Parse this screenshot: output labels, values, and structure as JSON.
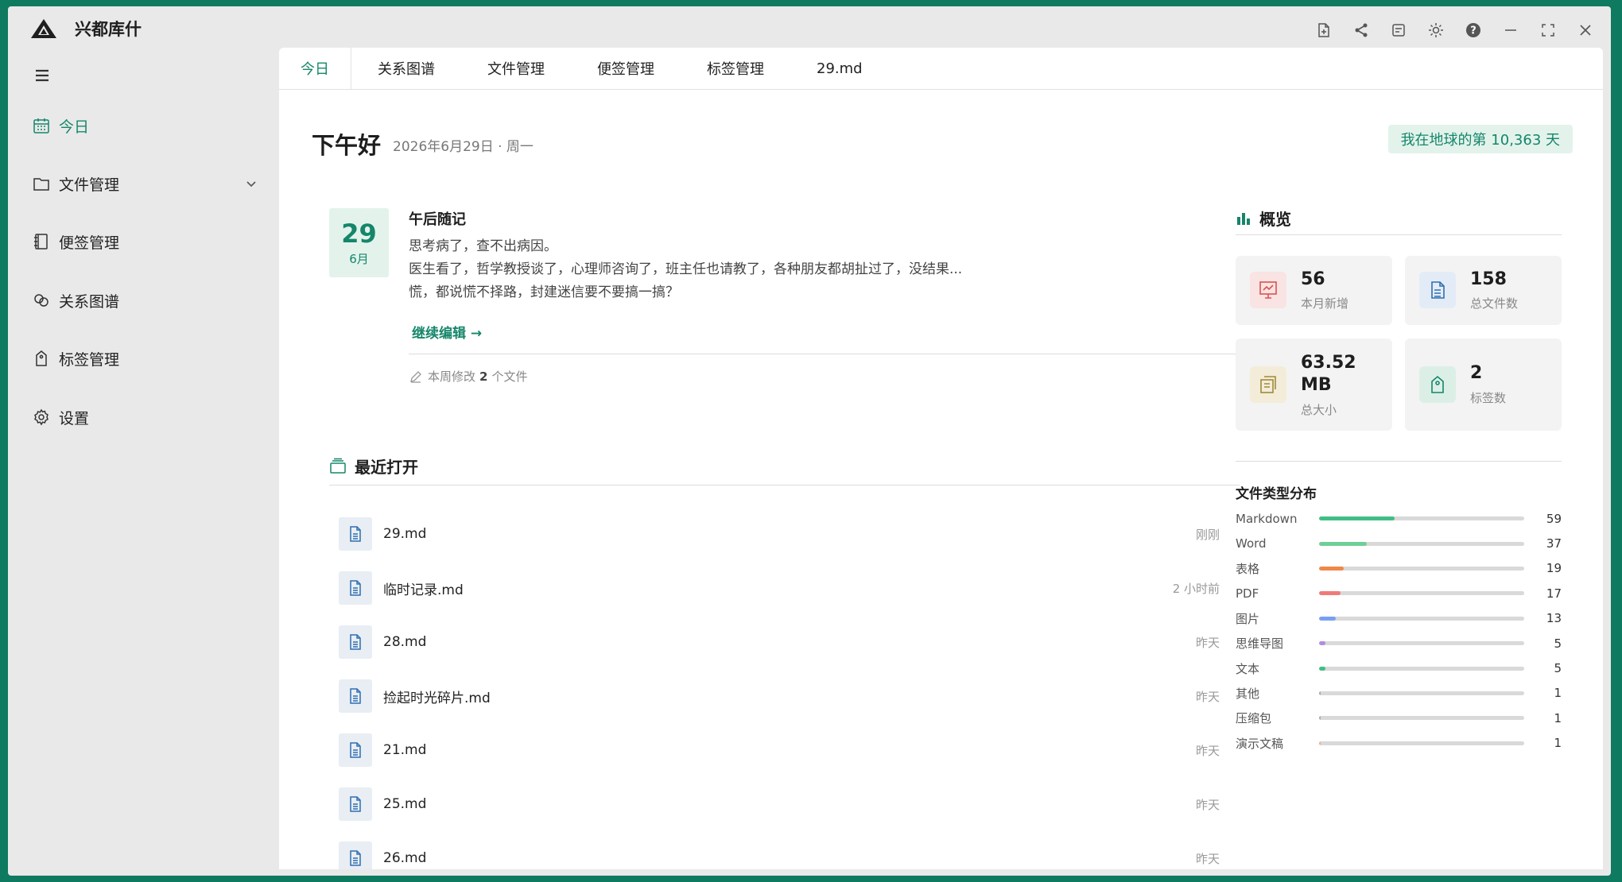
{
  "app": {
    "title": "兴都库什"
  },
  "titlebar": {
    "icons": [
      "new-file-icon",
      "share-icon",
      "export-icon",
      "theme-sun-icon",
      "help-icon",
      "minimize-icon",
      "maximize-icon",
      "close-icon"
    ]
  },
  "sidebar": {
    "items": [
      {
        "label": "今日",
        "icon": "calendar-icon",
        "active": true
      },
      {
        "label": "文件管理",
        "icon": "folder-icon",
        "expandable": true
      },
      {
        "label": "便签管理",
        "icon": "notebook-icon"
      },
      {
        "label": "关系图谱",
        "icon": "graph-icon"
      },
      {
        "label": "标签管理",
        "icon": "tag-icon"
      },
      {
        "label": "设置",
        "icon": "gear-icon"
      }
    ]
  },
  "tabs": [
    "今日",
    "关系图谱",
    "文件管理",
    "便签管理",
    "标签管理",
    "29.md"
  ],
  "header": {
    "greeting": "下午好",
    "date": "2026年6月29日 · 周一",
    "earth_days": "我在地球的第 10,363 天"
  },
  "note": {
    "day": "29",
    "month": "6月",
    "title": "午后随记",
    "lines": [
      "思考病了，查不出病因。",
      "医生看了，哲学教授谈了，心理师咨询了，班主任也请教了，各种朋友都胡扯过了，没结果...",
      "慌，都说慌不择路，封建迷信要不要搞一搞？"
    ],
    "continue": "继续编辑 →",
    "week_prefix": "本周修改",
    "week_count": "2",
    "week_suffix": "个文件"
  },
  "recent": {
    "title": "最近打开",
    "items": [
      {
        "name": "29.md",
        "time": "刚刚"
      },
      {
        "name": "临时记录.md",
        "time": "2 小时前"
      },
      {
        "name": "28.md",
        "time": "昨天"
      },
      {
        "name": "捡起时光碎片.md",
        "time": "昨天"
      },
      {
        "name": "21.md",
        "time": "昨天"
      },
      {
        "name": "25.md",
        "time": "昨天"
      },
      {
        "name": "26.md",
        "time": "昨天"
      }
    ]
  },
  "overview": {
    "title": "概览",
    "stats": [
      {
        "value": "56",
        "label": "本月新增",
        "icon": "chart-board-icon",
        "color": "#d9534f"
      },
      {
        "value": "158",
        "label": "总文件数",
        "icon": "document-icon",
        "color": "#2f6fb0"
      },
      {
        "value": "63.52 MB",
        "label": "总大小",
        "icon": "stack-icon",
        "color": "#a08a3a"
      },
      {
        "value": "2",
        "label": "标签数",
        "icon": "tag-icon",
        "color": "#15866a"
      }
    ]
  },
  "file_types": {
    "title": "文件类型分布",
    "items": [
      {
        "label": "Markdown",
        "count": 59,
        "ratio": 0.369,
        "color": "#3fbf84"
      },
      {
        "label": "Word",
        "count": 37,
        "ratio": 0.231,
        "color": "#6fcf97"
      },
      {
        "label": "表格",
        "count": 19,
        "ratio": 0.119,
        "color": "#f0884a"
      },
      {
        "label": "PDF",
        "count": 17,
        "ratio": 0.106,
        "color": "#f07a7a"
      },
      {
        "label": "图片",
        "count": 13,
        "ratio": 0.081,
        "color": "#7b9ff0"
      },
      {
        "label": "思维导图",
        "count": 5,
        "ratio": 0.031,
        "color": "#b38bdf"
      },
      {
        "label": "文本",
        "count": 5,
        "ratio": 0.031,
        "color": "#3fbf84"
      },
      {
        "label": "其他",
        "count": 1,
        "ratio": 0.006,
        "color": "#aaaaaa"
      },
      {
        "label": "压缩包",
        "count": 1,
        "ratio": 0.006,
        "color": "#aaaaaa"
      },
      {
        "label": "演示文稿",
        "count": 1,
        "ratio": 0.006,
        "color": "#f0b08a"
      }
    ]
  }
}
